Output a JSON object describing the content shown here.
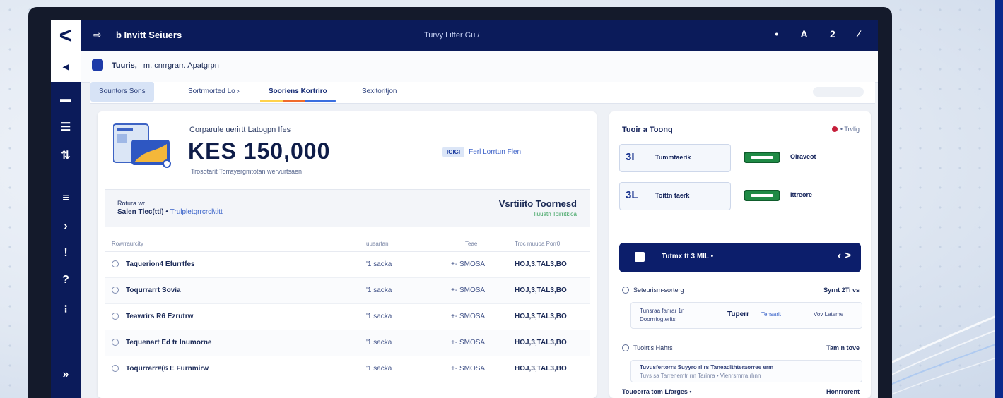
{
  "titlebar": {
    "back_label": "<",
    "app_title": "b Invitt Seiuers",
    "center_title": "Turvy Lifter Gu /",
    "icons_text": "• A 2 ⁄"
  },
  "breadcrumb": {
    "label": "Tuuris,",
    "path": "m. cnrrgrarr. Apatgrpn"
  },
  "tabs": [
    {
      "label": "Sountors Sons"
    },
    {
      "label": "Sortrmorted Lo ›"
    },
    {
      "label": "Sooriens Kortriro"
    },
    {
      "label": "Sexitoritjon"
    }
  ],
  "hero": {
    "caption": "Corparule uerirtt Latogpn Ifes",
    "amount": "KES 150,000",
    "subtitle": "Trosotarit Torrayergmtotan wervurtsaen",
    "link_badge": "IGIGI",
    "link_text": "Ferl Lorrtun Flen"
  },
  "summary": {
    "line1": "Rotura wr",
    "line2_bold": "Salen Tlec(ttl) •",
    "line2_link": "Trulpletgrrcrcl\\titt",
    "right_title": "Vsrtiiito Toornesd",
    "right_sub": "Iiuuatn Toirritkioa"
  },
  "table": {
    "headers": [
      "Rowrraurcity",
      "uueartan",
      "Teae",
      "Troc muuoa Porr0"
    ],
    "rows": [
      {
        "name": "Taquerion4 Efurrtfes",
        "pct": "'1 sacka",
        "delta": "+- SMOSA",
        "amount": "HOJ,3,TAL3,BO"
      },
      {
        "name": "Toqurrarrt Sovia",
        "pct": "'1 sacka",
        "delta": "+- SMOSA",
        "amount": "HOJ,3,TAL3,BO"
      },
      {
        "name": "Teawrirs R6 Ezrutrw",
        "pct": "'1 sacka",
        "delta": "+- SMOSA",
        "amount": "HOJ,3,TAL3,BO"
      },
      {
        "name": "Tequenart Ed tr Inumorne",
        "pct": "'1 sacka",
        "delta": "+- SMOSA",
        "amount": "HOJ,3,TAL3,BO"
      },
      {
        "name": "Toqurrarr#(6 E Furnmirw",
        "pct": "'1 sacka",
        "delta": "+- SMOSA",
        "amount": "HOJ,3,TAL3,BO"
      }
    ]
  },
  "side": {
    "heading": "Tuoir a Toonq",
    "status": "• Trvlig",
    "accounts": [
      {
        "icon": "3I",
        "name": "Tummtaerik",
        "action": "Oiraveot"
      },
      {
        "icon": "3L",
        "name": "Toittn taerk",
        "action": "Ittreore"
      }
    ],
    "cta_label": "Tutmx tt 3 MIL •",
    "cta_arrow": "‹ >",
    "section1_title": "Seteurism-sorterg",
    "section1_right": "Syrnt 2Ti vs",
    "section1_inner_a": "Tunsraa fanrar 1n",
    "section1_inner_b": "Doorrriogterits",
    "section1_inner_c": "Tuperr",
    "section1_inner_d": "Tensarit",
    "section1_inner_e": "Vov Lateme",
    "section2_title": "Tuoirtis Hahrs",
    "section2_right": "Tam n tove",
    "section2_inner": "Tuvusfertorrs Suyyro ri rs Taneadithteraorree erm",
    "section2_inner_sub": "Tuvs sa Tarrenemtr rm  Tarinra •  Vienrsrnrra rhnn",
    "section3_title": "Touoorra tom Lfarges •",
    "section3_right": "Honrrorent"
  }
}
